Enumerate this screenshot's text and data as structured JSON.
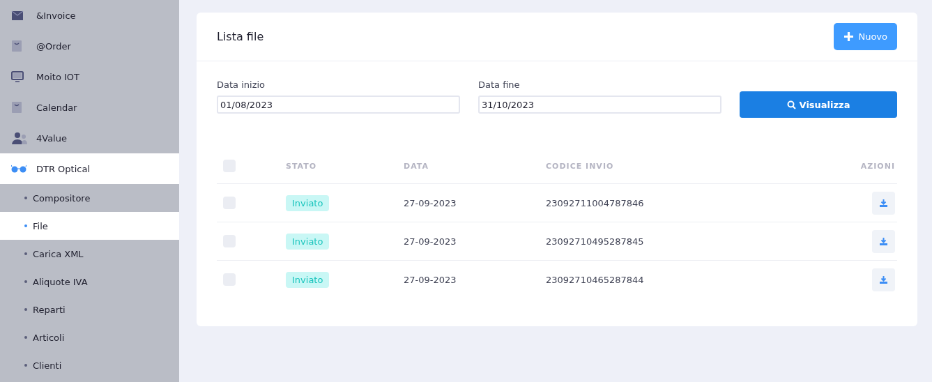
{
  "sidebar": {
    "items": [
      {
        "label": "&Invoice",
        "selected": false
      },
      {
        "label": "@Order",
        "selected": false
      },
      {
        "label": "Moito IOT",
        "selected": false
      },
      {
        "label": "Calendar",
        "selected": false
      },
      {
        "label": "4Value",
        "selected": false
      },
      {
        "label": "DTR Optical",
        "selected": true,
        "children": [
          {
            "label": "Compositore",
            "selected": false
          },
          {
            "label": "File",
            "selected": true
          },
          {
            "label": "Carica XML",
            "selected": false
          },
          {
            "label": "Aliquote IVA",
            "selected": false
          },
          {
            "label": "Reparti",
            "selected": false
          },
          {
            "label": "Articoli",
            "selected": false
          },
          {
            "label": "Clienti",
            "selected": false
          }
        ]
      }
    ]
  },
  "card": {
    "title": "Lista file",
    "new_button": "Nuovo",
    "filters": [
      {
        "label": "Data inizio",
        "value": "01/08/2023"
      },
      {
        "label": "Data fine",
        "value": "31/10/2023"
      }
    ],
    "search_button": "Visualizza",
    "table": {
      "select_all_checked": false,
      "columns": [
        "STATO",
        "DATA",
        "CODICE INVIO",
        "AZIONI"
      ],
      "rows": [
        {
          "checked": false,
          "status": "Inviato",
          "date": "27-09-2023",
          "code": "23092711004787846"
        },
        {
          "checked": false,
          "status": "Inviato",
          "date": "27-09-2023",
          "code": "23092710495287845"
        },
        {
          "checked": false,
          "status": "Inviato",
          "date": "27-09-2023",
          "code": "23092710465287844"
        }
      ]
    }
  }
}
